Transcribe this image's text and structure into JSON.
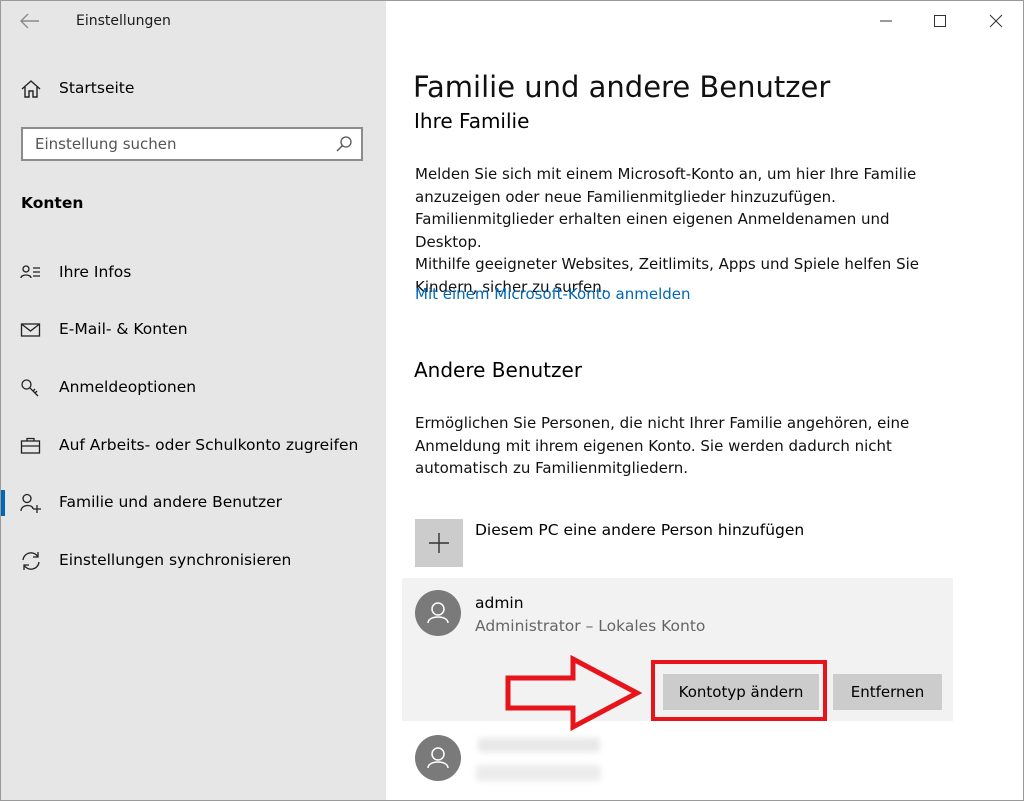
{
  "window": {
    "title": "Einstellungen",
    "controls": [
      "minimize",
      "maximize",
      "close"
    ]
  },
  "sidebar": {
    "home_label": "Startseite",
    "search": {
      "placeholder": "Einstellung suchen",
      "value": ""
    },
    "section_title": "Konten",
    "items": [
      {
        "label": "Ihre Infos",
        "icon": "contact-info-icon",
        "selected": false
      },
      {
        "label": "E-Mail- & Konten",
        "icon": "mail-icon",
        "selected": false
      },
      {
        "label": "Anmeldeoptionen",
        "icon": "key-icon",
        "selected": false
      },
      {
        "label": "Auf Arbeits- oder Schulkonto zugreifen",
        "icon": "briefcase-icon",
        "selected": false
      },
      {
        "label": "Familie und andere Benutzer",
        "icon": "add-user-icon",
        "selected": true
      },
      {
        "label": "Einstellungen synchronisieren",
        "icon": "sync-icon",
        "selected": false
      }
    ]
  },
  "main": {
    "page_title": "Familie und andere Benutzer",
    "family": {
      "heading": "Ihre Familie",
      "description_lines": [
        "Melden Sie sich mit einem Microsoft-Konto an, um hier Ihre Familie",
        "anzuzeigen oder neue Familienmitglieder hinzuzufügen.",
        "Familienmitglieder erhalten einen eigenen Anmeldenamen und Desktop.",
        "Mithilfe geeigneter Websites, Zeitlimits, Apps und Spiele helfen Sie",
        "Kindern, sicher zu surfen."
      ],
      "signin_link": "Mit einem Microsoft-Konto anmelden"
    },
    "other_users": {
      "heading": "Andere Benutzer",
      "description_lines": [
        "Ermöglichen Sie Personen, die nicht Ihrer Familie angehören, eine",
        "Anmeldung mit ihrem eigenen Konto. Sie werden dadurch nicht",
        "automatisch zu Familienmitgliedern."
      ],
      "add_label": "Diesem PC eine andere Person hinzufügen",
      "users": [
        {
          "name": "admin",
          "role": "Administrator – Lokales Konto",
          "expanded": true,
          "buttons": {
            "change_type": "Kontotyp ändern",
            "remove": "Entfernen"
          }
        }
      ]
    }
  },
  "annotation": {
    "color": "#e8141c"
  },
  "colors": {
    "accent": "#0067b8",
    "sidebar_bg": "#e6e6e6",
    "card_bg": "#f2f2f2",
    "button_bg": "#cccccc"
  }
}
